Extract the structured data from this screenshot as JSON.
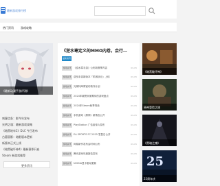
{
  "header": {
    "logo_text": "最新游戏排行榜",
    "search_placeholder": ""
  },
  "nav": {
    "items": [
      "热门资讯",
      "游戏攻略"
    ]
  },
  "hero": {
    "caption": "《最新动漫手游评测》",
    "dots": [
      false,
      true,
      false
    ]
  },
  "left_list": {
    "items": [
      "刺客信条：影今年发布",
      "光明之魂：最新游戏攻略",
      "《暗黑地牢2》DLC 今日发布",
      "古墓丽影：暗影版本更新",
      "新版本正式上线",
      "《暗黑破坏神4》最新赛季开启",
      "Steam 新游戏推荐"
    ],
    "more_label": "更多资讯"
  },
  "middle": {
    "title": "《逆水寒定义的MMO内卷，会行…",
    "featured_tag": "最新资讯",
    "rows": [
      {
        "tag": "游戏资讯",
        "text": "《逆水寒手游》公布新赛季内容",
        "date": "09-05"
      },
      {
        "tag": "游戏资讯",
        "text": "逆战手游新版本「机械战记」上线",
        "date": "09-05"
      },
      {
        "tag": "游戏资讯",
        "text": "光荣特库摩宣布新作计划",
        "date": "09-05"
      },
      {
        "tag": "游戏资讯",
        "text": "2024年最受玩家期待的游戏盘点",
        "date": "09-05"
      },
      {
        "tag": "游戏资讯",
        "text": "2024年Steam秋季特卖",
        "date": "09-05"
      },
      {
        "tag": "游戏资讯",
        "text": "手机游戏《原神》新角色公开",
        "date": "09-05"
      },
      {
        "tag": "游戏资讯",
        "text": "PlayStation 广告宣传片发布",
        "date": "09-05"
      },
      {
        "tag": "游戏资讯",
        "text": "EA SPORTS FC 2025 发售日公开",
        "date": "09-05"
      },
      {
        "tag": "游戏资讯",
        "text": "网易新作发布会时间公布",
        "date": "09-05"
      },
      {
        "tag": "游戏资讯",
        "text": "腾讯游戏年度报告发布",
        "date": "09-05"
      },
      {
        "tag": "游戏资讯",
        "text": "NVIDIA显卡驱动更新",
        "date": "09-05"
      }
    ]
  },
  "right": {
    "thumbs": [
      {
        "caption": "《暗黑破坏神》",
        "bg": "#4a3a2a"
      },
      {
        "caption": "原神冒险之旅",
        "bg": "#2a3a2a"
      },
      {
        "caption": "《黑暗之魂》",
        "bg": "#1a1a20"
      },
      {
        "caption": "25周年庆",
        "bg": "#1a2a4a"
      }
    ],
    "big_number": "25"
  },
  "colors": {
    "accent": "#1e88c8",
    "logo": "#3a7bd5"
  }
}
